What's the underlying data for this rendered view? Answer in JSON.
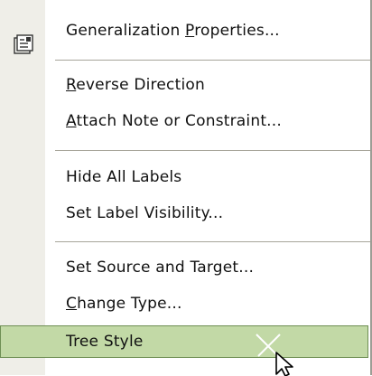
{
  "menu": {
    "properties": {
      "label_pre": "Generalization ",
      "label_key": "P",
      "label_post": "roperties..."
    },
    "reverse": {
      "label_pre": "",
      "label_key": "R",
      "label_post": "everse Direction"
    },
    "attach": {
      "label_pre": "",
      "label_key": "A",
      "label_post": "ttach Note or Constraint..."
    },
    "hide_labels": {
      "label": "Hide All Labels"
    },
    "label_visibility": {
      "label": "Set Label Visibility..."
    },
    "source_target": {
      "label": "Set Source and Target..."
    },
    "change_type": {
      "label_pre": "",
      "label_key": "C",
      "label_post": "hange Type..."
    },
    "tree_style": {
      "label": "Tree Style"
    }
  },
  "icons": {
    "properties": "properties-sheet-icon",
    "cursor": "mouse-pointer-icon"
  },
  "colors": {
    "highlight_bg": "#c2d9a6",
    "highlight_border": "#6f8f55",
    "gutter": "#efeee8",
    "separator": "#a7a59a"
  }
}
